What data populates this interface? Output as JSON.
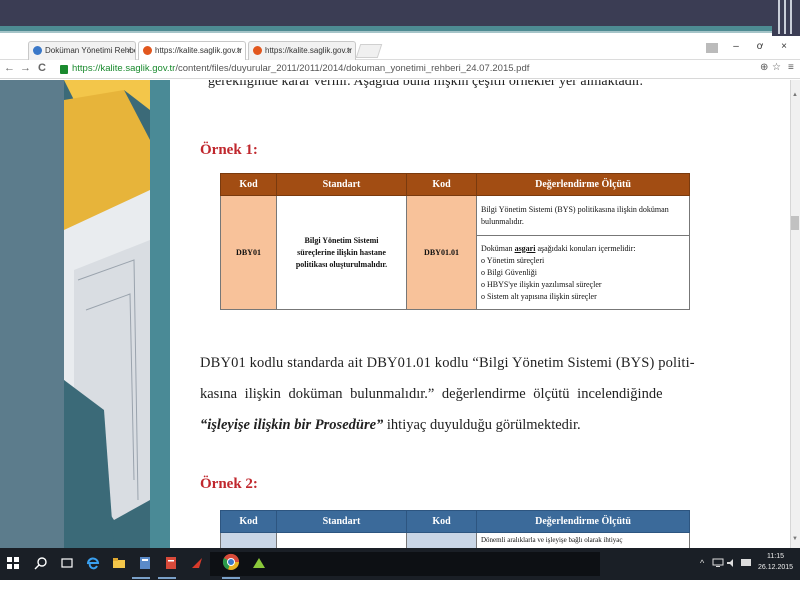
{
  "browser": {
    "tabs": [
      {
        "label": "Doküman Yönetimi Rehbe",
        "close": "×"
      },
      {
        "label": "https://kalite.saglik.gov.tr",
        "close": "×"
      },
      {
        "label": "https://kalite.saglik.gov.tr",
        "close": "×"
      }
    ],
    "window_controls": {
      "minimize": "–",
      "maximize": "ơ",
      "close": "×"
    },
    "nav": {
      "back": "←",
      "forward": "→",
      "reload": "C"
    },
    "url": {
      "scheme": "https://",
      "host": "kalite.saglik.gov.tr",
      "path": "/content/files/duyurular_2011/2011/2014/dokuman_yonetimi_rehberi_24.07.2015.pdf"
    },
    "zoom_icon": "⊕",
    "star_icon": "☆",
    "menu_icon": "≡"
  },
  "document": {
    "clipped_line": "gerekliğinde karar verilir. Aşağıda buna ilişkin çeşitli örnekler yer almaktadır.",
    "example1": {
      "heading": "Örnek 1:",
      "headers": [
        "Kod",
        "Standart",
        "Kod",
        "Değerlendirme Ölçütü"
      ],
      "standard_code": "DBY01",
      "standard_text": "Bilgi Yönetim Sistemi süreçlerine ilişkin hastane politikası oluşturulmalıdır.",
      "criterion_code": "DBY01.01",
      "criterion_1": "Bilgi Yönetim Sistemi (BYS) politikasına ilişkin doküman bulunmalıdır.",
      "criterion_2_intro_a": "Doküman ",
      "criterion_2_intro_b": "asgari",
      "criterion_2_intro_c": " aşağıdaki konuları içermelidir:",
      "criterion_2_items": [
        "o Yönetim süreçleri",
        "o Bilgi Güvenliği",
        "o HBYS'ye ilişkin yazılımsal süreçler",
        "o Sistem alt yapısına ilişkin süreçler"
      ]
    },
    "paragraph": {
      "line1": "DBY01 kodlu standarda ait DBY01.01 kodlu “Bilgi Yönetim Sistemi (BYS) politi-",
      "line2": "kasına ilişkin doküman bulunmalıdır.” değerlendirme ölçütü incelendiğinde",
      "line3_emph": "“işleyişe ilişkin bir Prosedüre”",
      "line3_rest": " ihtiyaç duyulduğu görülmektedir."
    },
    "example2": {
      "heading": "Örnek 2:",
      "headers": [
        "Kod",
        "Standart",
        "Kod",
        "Değerlendirme Ölçütü"
      ],
      "partial_row": "Dönemli aralıklarla ve işleyişe bağlı olarak ihtiyaç"
    }
  },
  "taskbar": {
    "tray_chevron": "^",
    "clock_time": "11:15",
    "clock_date": "26.12.2015"
  },
  "colors": {
    "table1_header": "#a24d13",
    "table1_code_cell": "#f8c29a",
    "table2_header": "#3b6a9a",
    "heading_red": "#c0272d"
  }
}
